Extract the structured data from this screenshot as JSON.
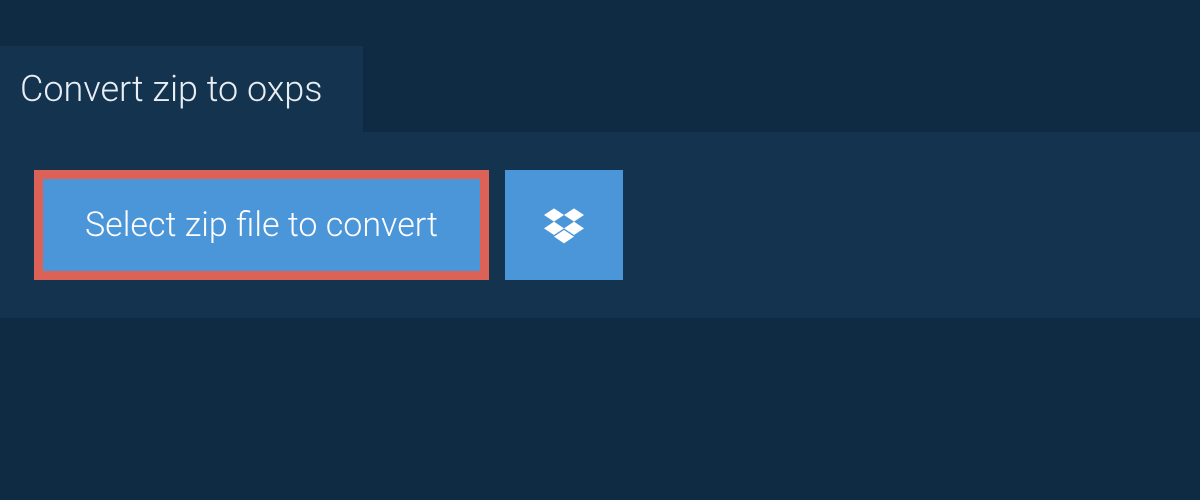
{
  "header": {
    "title": "Convert zip to oxps"
  },
  "actions": {
    "select_file_label": "Select zip file to convert"
  },
  "colors": {
    "background": "#0f2a43",
    "panel": "#14334f",
    "button_bg": "#4b95d9",
    "highlight_border": "#dc6258",
    "text_light": "#e8eef4"
  }
}
